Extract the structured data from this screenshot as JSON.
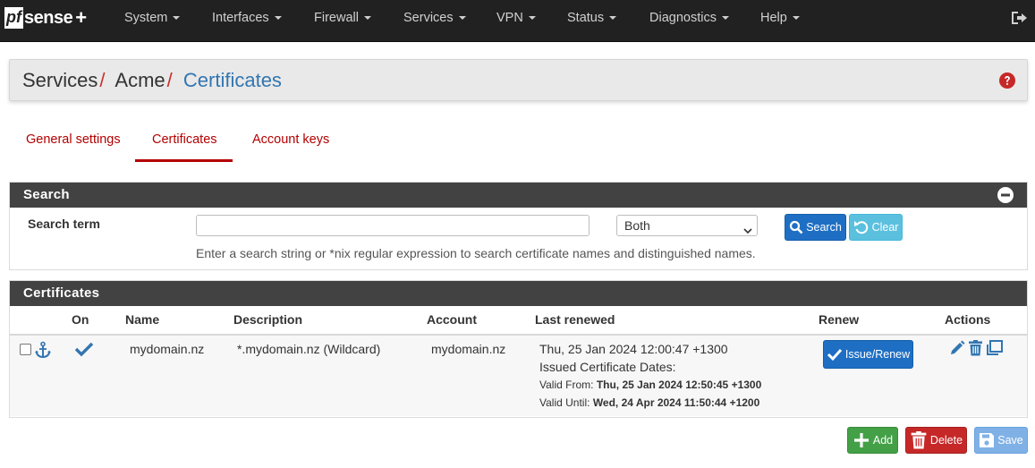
{
  "brand": {
    "pf": "pf",
    "sense": "sense",
    "plus": "+"
  },
  "nav": {
    "items": [
      {
        "label": "System"
      },
      {
        "label": "Interfaces"
      },
      {
        "label": "Firewall"
      },
      {
        "label": "Services"
      },
      {
        "label": "VPN"
      },
      {
        "label": "Status"
      },
      {
        "label": "Diagnostics"
      },
      {
        "label": "Help"
      }
    ]
  },
  "breadcrumb": {
    "items": [
      "Services",
      "Acme",
      "Certificates"
    ],
    "separator": "/"
  },
  "tabs": [
    {
      "label": "General settings",
      "active": false
    },
    {
      "label": "Certificates",
      "active": true
    },
    {
      "label": "Account keys",
      "active": false
    }
  ],
  "search_panel": {
    "title": "Search",
    "term_label": "Search term",
    "input_value": "",
    "select_value": "Both",
    "search_button": "Search",
    "clear_button": "Clear",
    "help": "Enter a search string or *nix regular expression to search certificate names and distinguished names."
  },
  "certs_panel": {
    "title": "Certificates",
    "columns": [
      "On",
      "Name",
      "Description",
      "Account",
      "Last renewed",
      "Renew",
      "Actions"
    ],
    "rows": [
      {
        "name": "mydomain.nz",
        "description": "*.mydomain.nz (Wildcard)",
        "account": "mydomain.nz",
        "last_renewed": "Thu, 25 Jan 2024 12:00:47 +1300",
        "issued_label": "Issued Certificate Dates:",
        "valid_from_label": "Valid From:",
        "valid_from": "Thu, 25 Jan 2024 12:50:45 +1300",
        "valid_until_label": "Valid Until:",
        "valid_until": "Wed, 24 Apr 2024 11:50:44 +1200",
        "renew_button": "Issue/Renew"
      }
    ]
  },
  "footer_buttons": {
    "add": "Add",
    "delete": "Delete",
    "save": "Save"
  },
  "colors": {
    "nav_bg": "#212121",
    "accent_red": "#b40000",
    "link_blue": "#3276b1",
    "panel_heading": "#424242"
  }
}
